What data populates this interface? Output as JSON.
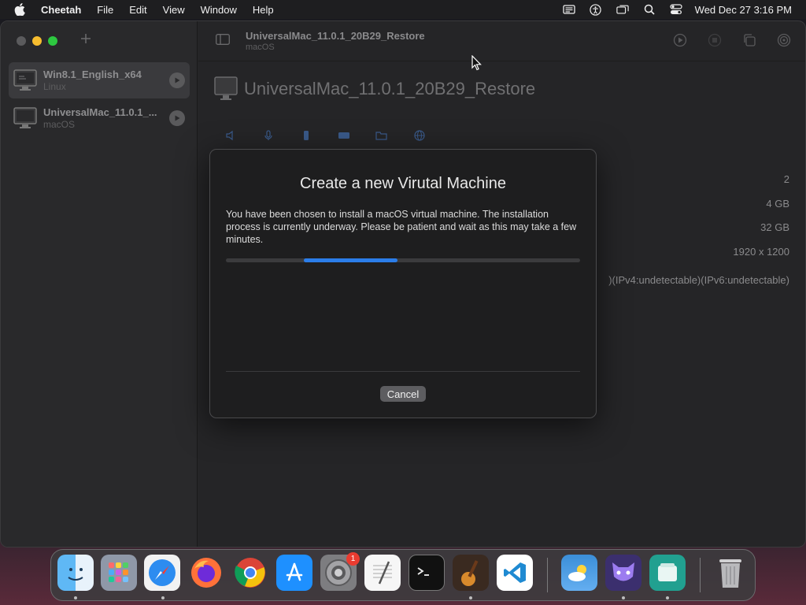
{
  "menubar": {
    "app_name": "Cheetah",
    "items": [
      "File",
      "Edit",
      "View",
      "Window",
      "Help"
    ],
    "clock": "Wed Dec 27  3:16 PM",
    "status_icons": [
      "menu-extra-icon",
      "accessibility-icon",
      "screen-mirroring-icon",
      "search-icon",
      "control-center-icon"
    ]
  },
  "sidebar": {
    "vms": [
      {
        "name": "Win8.1_English_x64",
        "os": "Linux",
        "selected": true
      },
      {
        "name": "UniversalMac_11.0.1_...",
        "os": "macOS",
        "selected": false
      }
    ]
  },
  "toolbar": {
    "title": "UniversalMac_11.0.1_20B29_Restore",
    "subtitle": "macOS"
  },
  "detail": {
    "title": "UniversalMac_11.0.1_20B29_Restore",
    "specs": {
      "cpus": "2",
      "memory": "4 GB",
      "disk": "32 GB",
      "display": "1920 x 1200",
      "network": ")(IPv4:undetectable)(IPv6:undetectable)"
    }
  },
  "dialog": {
    "title": "Create a new Virutal Machine",
    "message": "You have been chosen to install a macOS virtual machine. The installation process is currently underway. Please be patient and wait as this may take a few minutes.",
    "cancel_label": "Cancel",
    "progress": {
      "start": 0.22,
      "end": 0.485
    }
  },
  "dock": {
    "apps": [
      "Finder",
      "Launchpad",
      "Safari",
      "Firefox",
      "Chrome",
      "App Store",
      "System Preferences",
      "TextEdit",
      "Terminal",
      "GarageBand",
      "Visual Studio Code",
      "Weather",
      "Cheetah",
      "Files",
      "Trash"
    ],
    "system_prefs_badge": "1"
  },
  "colors": {
    "accent": "#2b7de9",
    "badge": "#ea3b30"
  }
}
